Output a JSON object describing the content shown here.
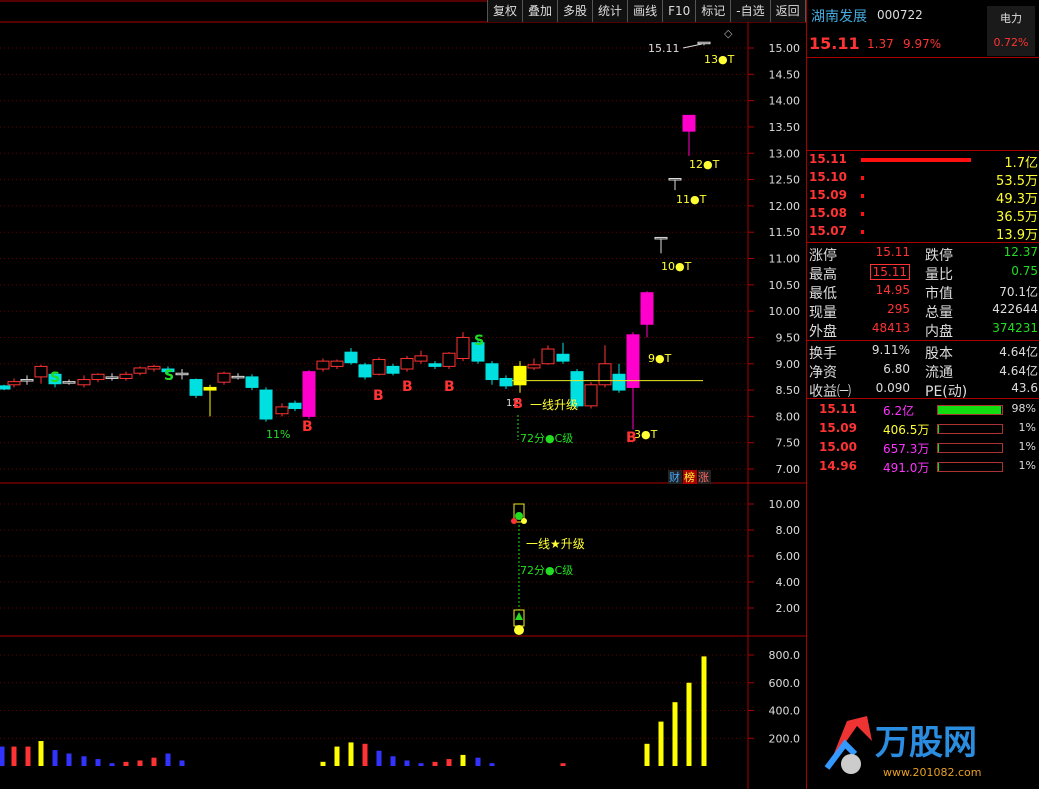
{
  "toolbar": [
    "复权",
    "叠加",
    "多股",
    "统计",
    "画线",
    "F10",
    "标记",
    "-自选",
    "返回"
  ],
  "stock": {
    "name": "湖南发展",
    "code": "000722",
    "price": "15.11",
    "change": "1.37",
    "pct": "9.97%"
  },
  "sector": {
    "name": "电力",
    "pct": "0.72%"
  },
  "price_axis": [
    "15.00",
    "14.50",
    "14.00",
    "13.50",
    "13.00",
    "12.50",
    "12.00",
    "11.50",
    "11.00",
    "10.50",
    "10.00",
    "9.50",
    "9.00",
    "8.50",
    "8.00",
    "7.50",
    "7.00"
  ],
  "indicator_axis": [
    "10.00",
    "8.00",
    "6.00",
    "4.00",
    "2.00"
  ],
  "volume_axis": [
    "800.0",
    "600.0",
    "400.0",
    "200.0"
  ],
  "annotations": {
    "high_label": "15.11",
    "t13": "13●T",
    "t12": "12●T",
    "t11": "11●T",
    "t10": "10●T",
    "t9": "9●T",
    "t3": "3●T",
    "s": "S",
    "b": "B",
    "pct11": "11%",
    "upgrade": "一线升级",
    "grade": "72分●C级",
    "upgrade2": "一线★升级",
    "grade2": "72分●C级",
    "cai": "财",
    "bang": "榜",
    "zhang": "涨",
    "sub_b": "B",
    "sub_12": "12"
  },
  "orderbook": [
    {
      "price": "15.11",
      "vol": "1.7亿"
    },
    {
      "price": "15.10",
      "vol": "53.5万"
    },
    {
      "price": "15.09",
      "vol": "49.3万"
    },
    {
      "price": "15.08",
      "vol": "36.5万"
    },
    {
      "price": "15.07",
      "vol": "13.9万"
    }
  ],
  "stats": [
    {
      "l1": "涨停",
      "v1": "15.11",
      "l2": "跌停",
      "v2": "12.37"
    },
    {
      "l1": "最高",
      "v1": "15.11",
      "l2": "量比",
      "v2": "0.75"
    },
    {
      "l1": "最低",
      "v1": "14.95",
      "l2": "市值",
      "v2": "70.1亿"
    },
    {
      "l1": "现量",
      "v1": "295",
      "l2": "总量",
      "v2": "422644"
    },
    {
      "l1": "外盘",
      "v1": "48413",
      "l2": "内盘",
      "v2": "374231"
    }
  ],
  "stats2": [
    {
      "l1": "换手",
      "v1": "9.11%",
      "l2": "股本",
      "v2": "4.64亿"
    },
    {
      "l1": "净资",
      "v1": "6.80",
      "l2": "流通",
      "v2": "4.64亿"
    },
    {
      "l1": "收益㈠",
      "v1": "0.090",
      "l2": "PE(动)",
      "v2": "43.6"
    }
  ],
  "dist": [
    {
      "price": "15.11",
      "amount": "6.2亿",
      "pct": "98%",
      "fill": 0.98
    },
    {
      "price": "15.09",
      "amount": "406.5万",
      "pct": "1%",
      "fill": 0.01
    },
    {
      "price": "15.00",
      "amount": "657.3万",
      "pct": "1%",
      "fill": 0.01
    },
    {
      "price": "14.96",
      "amount": "491.0万",
      "pct": "1%",
      "fill": 0.01
    }
  ],
  "logo": {
    "text": "万股网",
    "url": "www.201082.com"
  }
}
